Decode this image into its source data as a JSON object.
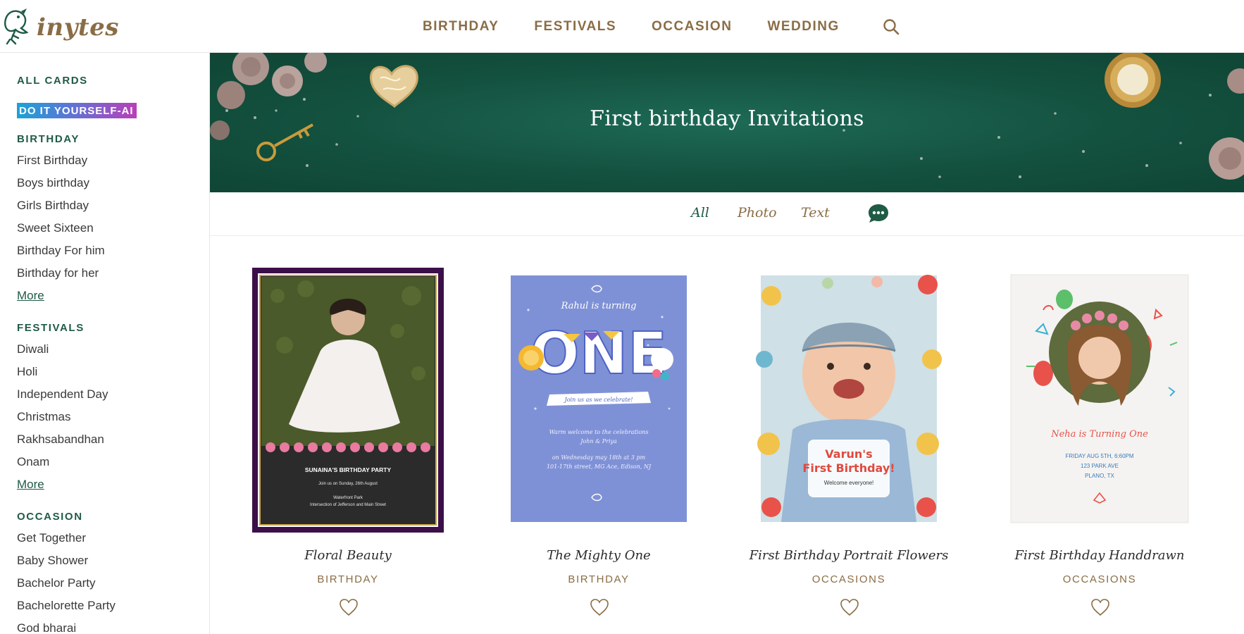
{
  "brand": {
    "name": "inytes"
  },
  "nav": {
    "items": [
      {
        "label": "BIRTHDAY"
      },
      {
        "label": "FESTIVALS"
      },
      {
        "label": "OCCASION"
      },
      {
        "label": "WEDDING"
      }
    ],
    "search_icon": "search-icon"
  },
  "sidebar": {
    "all_cards": "ALL CARDS",
    "ai_label": "DO IT YOURSELF-AI",
    "sections": [
      {
        "heading": "BIRTHDAY",
        "items": [
          "First Birthday",
          "Boys birthday",
          "Girls Birthday",
          "Sweet Sixteen",
          "Birthday For him",
          "Birthday for her"
        ],
        "more": "More"
      },
      {
        "heading": "FESTIVALS",
        "items": [
          "Diwali",
          "Holi",
          "Independent Day",
          "Christmas",
          "Rakhsabandhan",
          "Onam"
        ],
        "more": "More"
      },
      {
        "heading": "OCCASION",
        "items": [
          "Get Together",
          "Baby Shower",
          "Bachelor Party",
          "Bachelorette Party",
          "God bharai"
        ]
      }
    ]
  },
  "banner": {
    "title": "First birthday Invitations"
  },
  "filters": {
    "tabs": [
      {
        "label": "All",
        "active": true
      },
      {
        "label": "Photo",
        "active": false
      },
      {
        "label": "Text",
        "active": false
      }
    ],
    "chat_icon": "chat-bubble-icon"
  },
  "cards": [
    {
      "title": "Floral Beauty",
      "category": "BIRTHDAY",
      "preview": {
        "heading": "SUNAINA'S BIRTHDAY PARTY",
        "line1": "Join us on Sunday, 26th August",
        "line2": "Waterfront Park",
        "line3": "Intersection of Jefferson and Main Street"
      }
    },
    {
      "title": "The Mighty One",
      "category": "BIRTHDAY",
      "preview": {
        "heading": "Rahul is turning",
        "big": "ONE",
        "ribbon": "Join us as we celebrate!",
        "line1": "Warm welcome to the celebrations",
        "line2": "John & Priya",
        "line3": "on Wednesday may 18th at 3 pm",
        "line4": "101-17th street, MG Ace, Edison, NJ"
      }
    },
    {
      "title": "First Birthday Portrait Flowers",
      "category": "OCCASIONS",
      "preview": {
        "line1": "Varun's",
        "line2": "First Birthday!",
        "line3": "Welcome everyone!"
      }
    },
    {
      "title": "First Birthday Handdrawn",
      "category": "OCCASIONS",
      "preview": {
        "heading": "Neha is Turning One",
        "line1": "FRIDAY AUG 5TH, 6:60PM",
        "line2": "123 PARK AVE",
        "line3": "PLANO, TX"
      }
    }
  ],
  "colors": {
    "brand_brown": "#8a6d46",
    "brand_green": "#1f5b45",
    "banner_green": "#14513f"
  }
}
